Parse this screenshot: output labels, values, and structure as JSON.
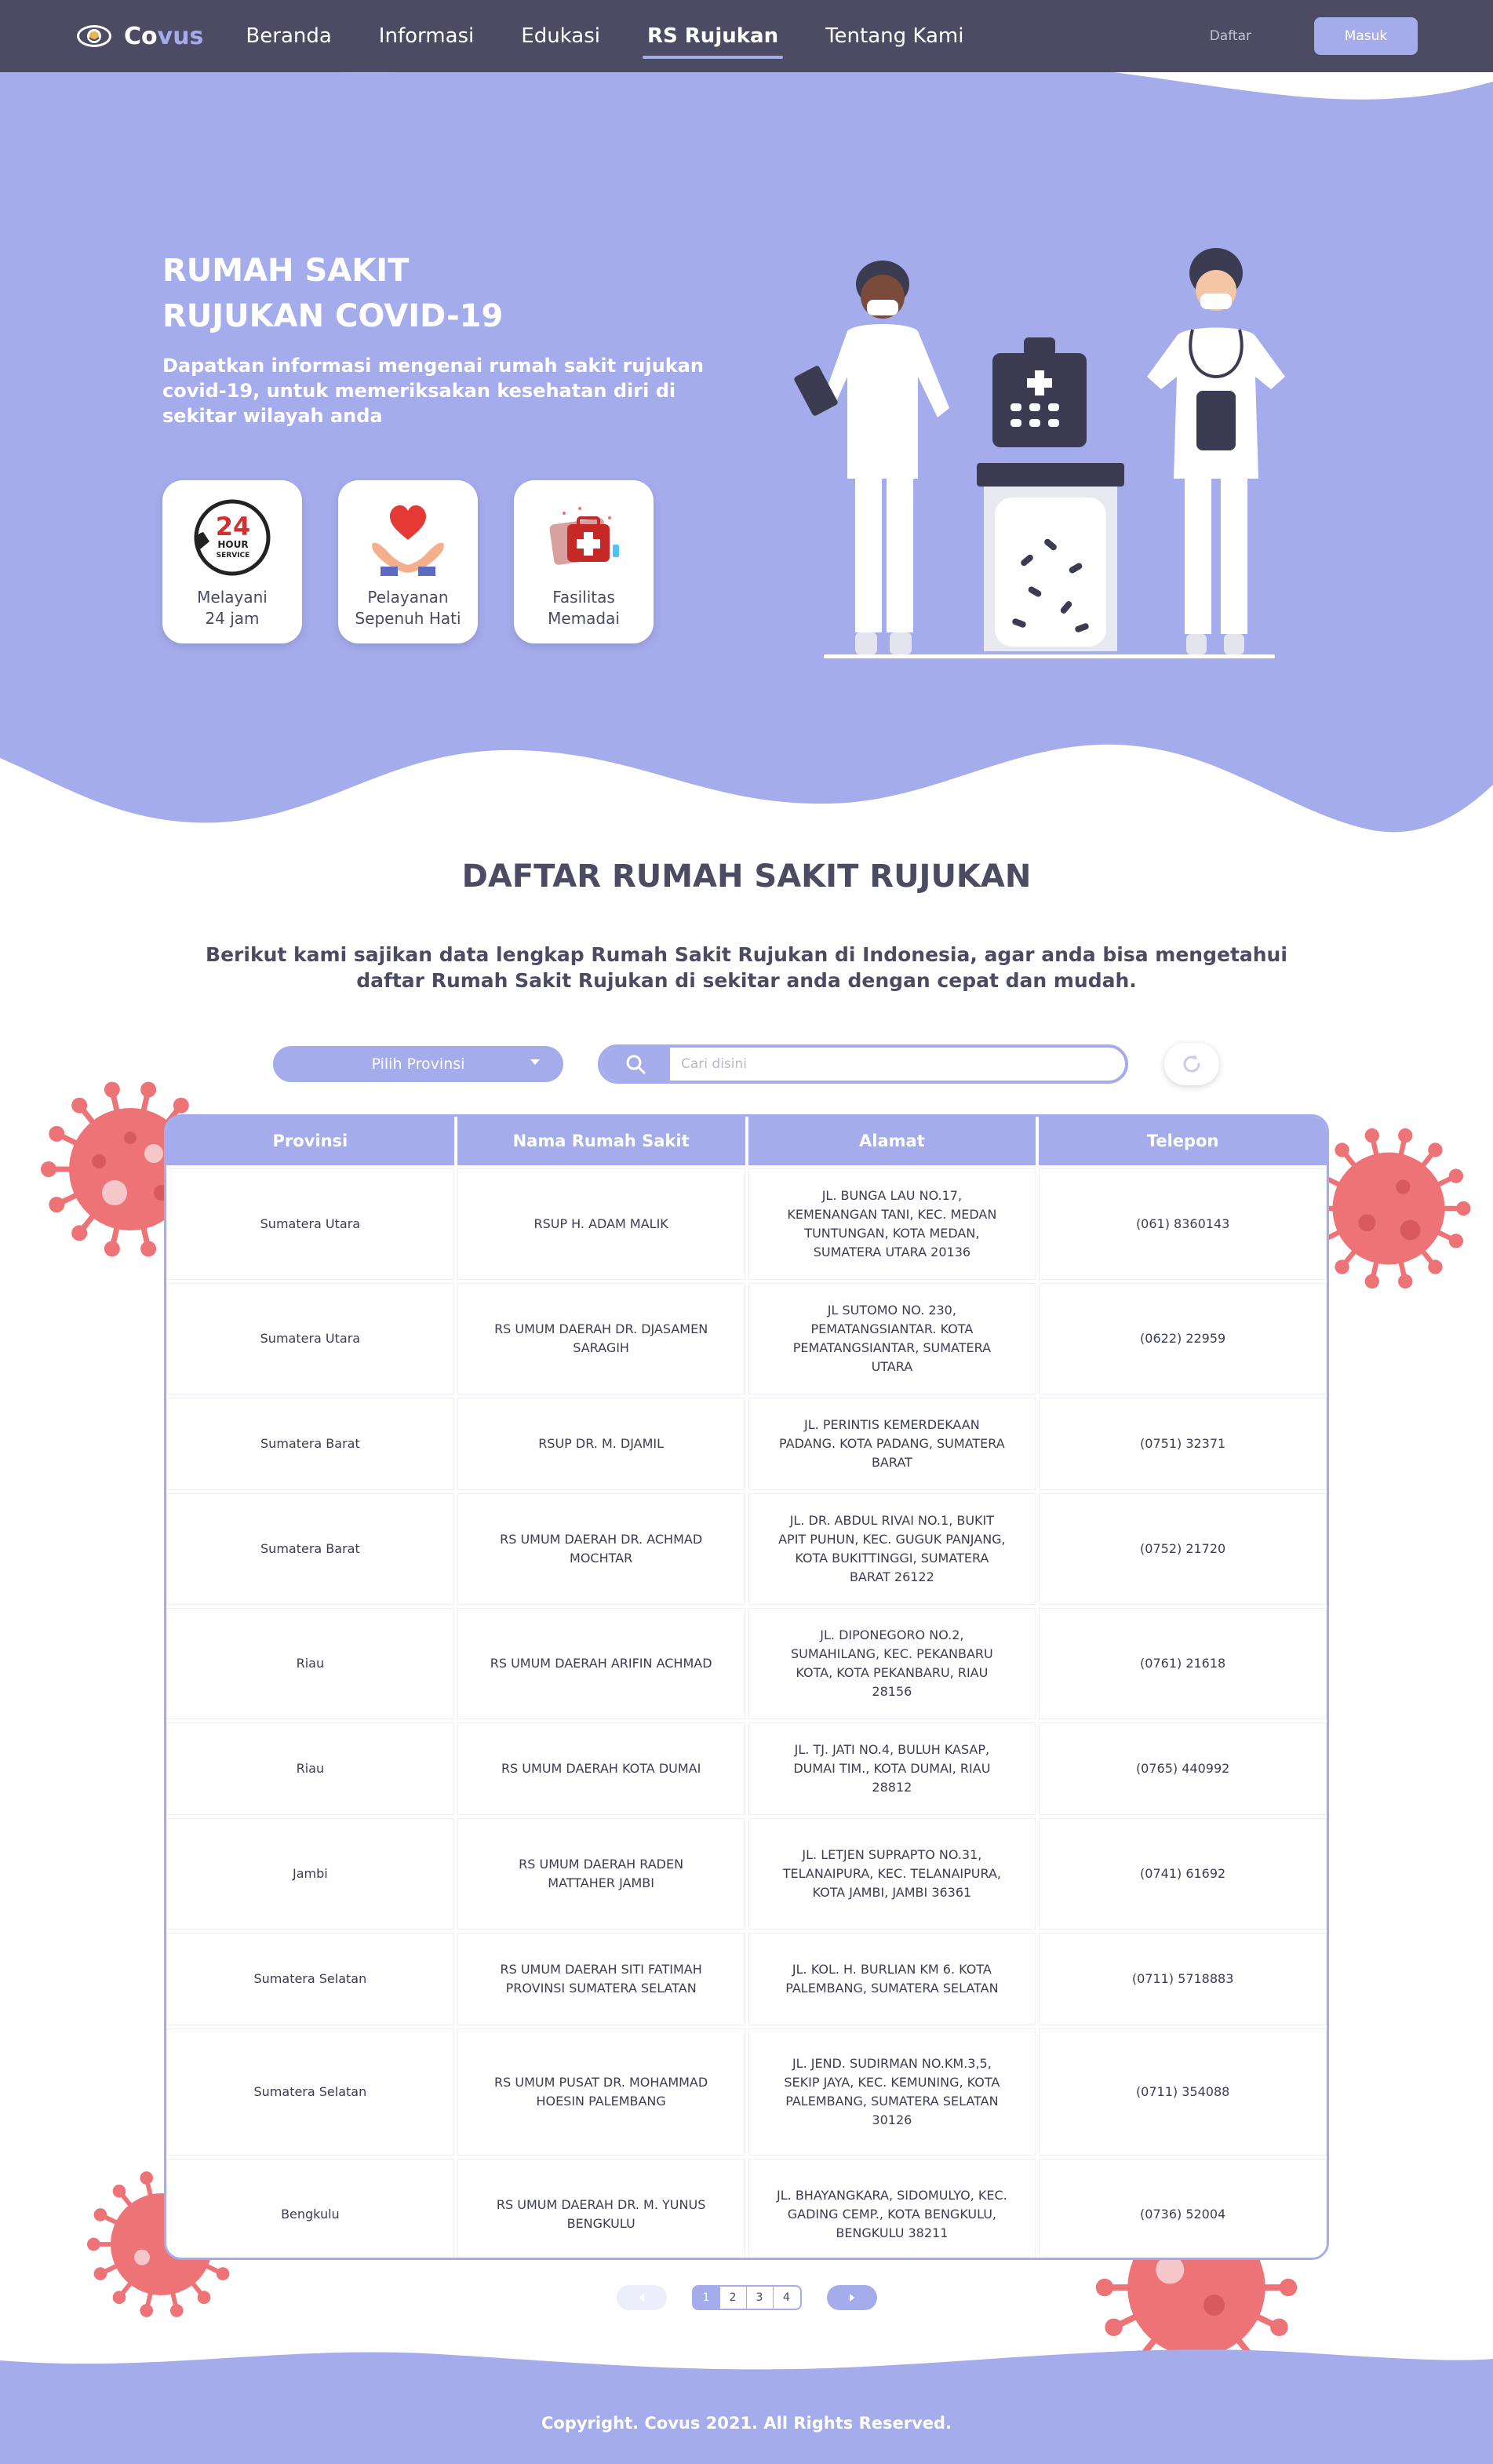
{
  "nav": {
    "brand_a": "Co",
    "brand_b": "vus",
    "links": [
      {
        "label": "Beranda"
      },
      {
        "label": "Informasi"
      },
      {
        "label": "Edukasi"
      },
      {
        "label": "RS Rujukan"
      },
      {
        "label": "Tentang Kami"
      }
    ],
    "active_index": 3,
    "daftar": "Daftar",
    "masuk": "Masuk"
  },
  "hero": {
    "title_line1": "RUMAH SAKIT",
    "title_line2": "RUJUKAN COVID-19",
    "description": "Dapatkan informasi mengenai rumah sakit rujukan covid-19, untuk memeriksakan kesehatan diri di sekitar wilayah anda",
    "features": [
      {
        "icon": "24-hour-service-icon",
        "label": "Melayani\n24 jam",
        "badge_num": "24",
        "badge_text1": "HOUR",
        "badge_text2": "SERVICE"
      },
      {
        "icon": "heart-hands-icon",
        "label": "Pelayanan\nSepenuh Hati"
      },
      {
        "icon": "medical-kit-icon",
        "label": "Fasilitas\nMemadai"
      }
    ]
  },
  "section": {
    "title": "DAFTAR RUMAH SAKIT RUJUKAN",
    "description": "Berikut kami sajikan data lengkap Rumah Sakit Rujukan di Indonesia, agar anda bisa mengetahui daftar Rumah Sakit Rujukan di sekitar anda dengan cepat dan mudah."
  },
  "filters": {
    "province_label": "Pilih Provinsi",
    "search_placeholder": "Cari disini"
  },
  "table": {
    "headers": [
      "Provinsi",
      "Nama Rumah Sakit",
      "Alamat",
      "Telepon"
    ],
    "rows": [
      {
        "provinsi": "Sumatera Utara",
        "nama": "RSUP H. ADAM MALIK",
        "alamat": "JL. BUNGA LAU NO.17, KEMENANGAN TANI, KEC. MEDAN TUNTUNGAN, KOTA MEDAN, SUMATERA UTARA 20136",
        "telepon": "(061) 8360143"
      },
      {
        "provinsi": "Sumatera Utara",
        "nama": "RS UMUM DAERAH DR. DJASAMEN SARAGIH",
        "alamat": "JL SUTOMO NO. 230, PEMATANGSIANTAR. KOTA PEMATANGSIANTAR, SUMATERA UTARA",
        "telepon": "(0622) 22959"
      },
      {
        "provinsi": "Sumatera Barat",
        "nama": "RSUP DR. M. DJAMIL",
        "alamat": "JL. PERINTIS KEMERDEKAAN PADANG. KOTA PADANG, SUMATERA BARAT",
        "telepon": "(0751) 32371"
      },
      {
        "provinsi": "Sumatera Barat",
        "nama": "RS UMUM DAERAH DR. ACHMAD MOCHTAR",
        "alamat": "JL. DR. ABDUL RIVAI NO.1, BUKIT APIT PUHUN, KEC. GUGUK PANJANG, KOTA BUKITTINGGI, SUMATERA BARAT 26122",
        "telepon": "(0752) 21720"
      },
      {
        "provinsi": "Riau",
        "nama": "RS UMUM DAERAH ARIFIN ACHMAD",
        "alamat": "JL. DIPONEGORO NO.2, SUMAHILANG, KEC. PEKANBARU KOTA, KOTA PEKANBARU, RIAU 28156",
        "telepon": "(0761) 21618"
      },
      {
        "provinsi": "Riau",
        "nama": "RS UMUM DAERAH KOTA DUMAI",
        "alamat": "JL. TJ. JATI NO.4, BULUH KASAP, DUMAI TIM., KOTA DUMAI, RIAU 28812",
        "telepon": "(0765) 440992"
      },
      {
        "provinsi": "Jambi",
        "nama": "RS UMUM DAERAH RADEN MATTAHER JAMBI",
        "alamat": "JL. LETJEN SUPRAPTO NO.31, TELANAIPURA, KEC. TELANAIPURA, KOTA JAMBI, JAMBI 36361",
        "telepon": "(0741) 61692"
      },
      {
        "provinsi": "Sumatera Selatan",
        "nama": "RS UMUM DAERAH SITI FATIMAH PROVINSI SUMATERA SELATAN",
        "alamat": "JL. KOL. H. BURLIAN KM 6. KOTA PALEMBANG, SUMATERA SELATAN",
        "telepon": "(0711) 5718883"
      },
      {
        "provinsi": "Sumatera Selatan",
        "nama": "RS UMUM PUSAT DR. MOHAMMAD HOESIN PALEMBANG",
        "alamat": "JL. JEND. SUDIRMAN NO.KM.3,5, SEKIP JAYA, KEC. KEMUNING, KOTA PALEMBANG, SUMATERA SELATAN 30126",
        "telepon": "(0711) 354088"
      },
      {
        "provinsi": "Bengkulu",
        "nama": "RS UMUM DAERAH DR. M. YUNUS BENGKULU",
        "alamat": "JL. BHAYANGKARA, SIDOMULYO, KEC. GADING CEMP., KOTA BENGKULU, BENGKULU 38211",
        "telepon": "(0736) 52004"
      }
    ]
  },
  "pagination": {
    "pages": [
      "1",
      "2",
      "3",
      "4"
    ],
    "active": 0
  },
  "footer": {
    "copyright": "Copyright. Covus 2021. All Rights Reserved."
  },
  "colors": {
    "nav_bg": "#4b4b63",
    "accent": "#a5aceb",
    "virus": "#ee7377"
  }
}
